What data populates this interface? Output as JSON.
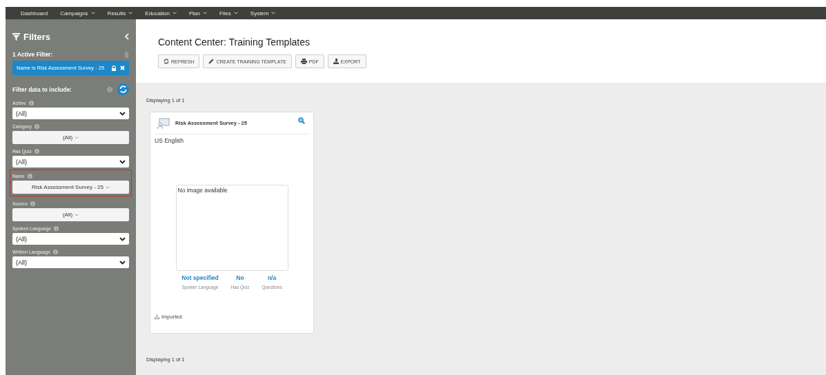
{
  "nav": [
    {
      "label": "Dashboard",
      "caret": false
    },
    {
      "label": "Campaigns",
      "caret": true
    },
    {
      "label": "Results",
      "caret": true
    },
    {
      "label": "Education",
      "caret": true
    },
    {
      "label": "Plan",
      "caret": true
    },
    {
      "label": "Files",
      "caret": true
    },
    {
      "label": "System",
      "caret": true
    }
  ],
  "sidebar": {
    "title": "Filters",
    "active_label": "1 Active Filter:",
    "active_filters": [
      "Name is Risk Assessment Survey - 25"
    ],
    "include_label": "Filter data to include:",
    "filters": [
      {
        "label": "Active",
        "kind": "select",
        "value": "(All)",
        "highlighted": false
      },
      {
        "label": "Category",
        "kind": "dropdown",
        "value": "(All)",
        "highlighted": false
      },
      {
        "label": "Has Quiz",
        "kind": "select",
        "value": "(All)",
        "highlighted": false
      },
      {
        "label": "Name",
        "kind": "dropdown",
        "value": "Risk Assessment Survey - 25",
        "highlighted": true
      },
      {
        "label": "Source",
        "kind": "dropdown",
        "value": "(All)",
        "highlighted": false
      },
      {
        "label": "Spoken Language",
        "kind": "select",
        "value": "(All)",
        "highlighted": false
      },
      {
        "label": "Written Language",
        "kind": "select",
        "value": "(All)",
        "highlighted": false
      }
    ]
  },
  "page": {
    "title": "Content Center: Training Templates",
    "buttons": [
      {
        "label": "REFRESH",
        "kind": "refresh"
      },
      {
        "label": "CREATE TRAINING TEMPLATE",
        "kind": "pencil"
      },
      {
        "label": "PDF",
        "kind": "print"
      },
      {
        "label": "EXPORT",
        "kind": "export"
      }
    ],
    "count_top": "Displaying 1 of 1",
    "count_bottom": "Displaying 1 of 1"
  },
  "cards": [
    {
      "title": "Risk Assessment Survey - 25",
      "language": "US English",
      "image_text": "No image available",
      "stats": [
        {
          "value": "Not specified",
          "label": "Spoken Language"
        },
        {
          "value": "No",
          "label": "Has Quiz"
        },
        {
          "value": "n/a",
          "label": "Questions"
        }
      ],
      "source": "Imported"
    }
  ]
}
